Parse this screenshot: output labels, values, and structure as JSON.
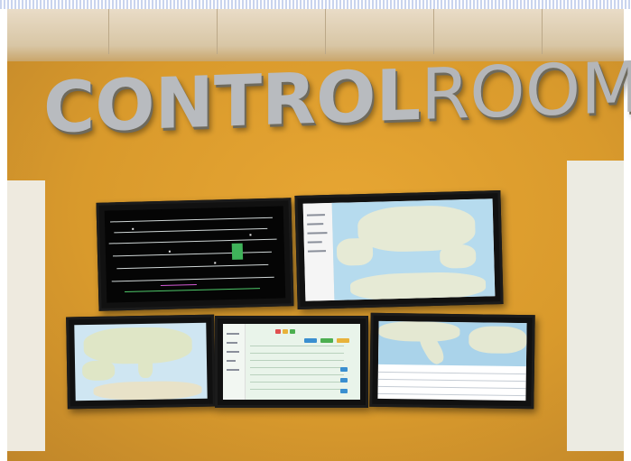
{
  "sign": {
    "part_bold": "CONTROL",
    "part_light": "ROOM"
  },
  "colors": {
    "wall": "#d99a2c",
    "sign_metal": "#a9acb0",
    "screen_bezel": "#1b1b1b",
    "map_sea": "#a8d3ea",
    "map_land": "#e6ead5",
    "track_green": "#4fc96a",
    "track_magenta": "#d25ad3"
  },
  "screens": [
    {
      "id": "top-left",
      "content": "track-diagram-icon"
    },
    {
      "id": "top-right",
      "content": "europe-map-icon"
    },
    {
      "id": "bottom-left",
      "content": "europe-map-icon"
    },
    {
      "id": "bottom-center",
      "content": "dashboard-table-icon"
    },
    {
      "id": "bottom-right",
      "content": "italy-map-icon"
    }
  ]
}
